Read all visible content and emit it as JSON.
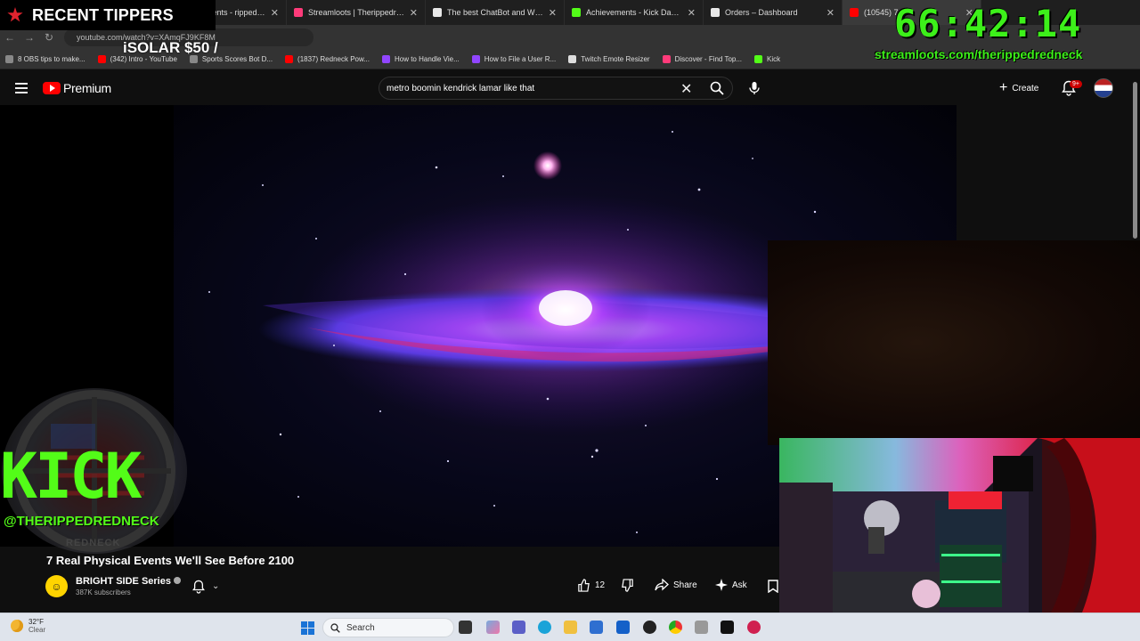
{
  "browser": {
    "tabs": [
      {
        "label": "Streamelements - rippedredne",
        "favicon_color": "#6bb7ff",
        "active": false
      },
      {
        "label": "Streamloots | Therippedredne",
        "favicon_color": "#ff3b7a",
        "active": false
      },
      {
        "label": "The best ChatBot and Widgets",
        "favicon_color": "#e8e8e8",
        "active": false
      },
      {
        "label": "Achievements - Kick Dashboar",
        "favicon_color": "#53fc18",
        "active": false
      },
      {
        "label": "Orders – Dashboard",
        "favicon_color": "#e8e8e8",
        "active": false
      },
      {
        "label": "(10545) 7 R",
        "favicon_color": "#ff0000",
        "active": true
      }
    ],
    "address": "youtube.com/watch?v=XAmqFJ9KF8M",
    "bookmarks": [
      {
        "label": "8 OBS tips to make...",
        "color": "#888888"
      },
      {
        "label": "(342) Intro - YouTube",
        "color": "#ff0000"
      },
      {
        "label": "Sports Scores Bot D...",
        "color": "#888888"
      },
      {
        "label": "(1837) Redneck Pow...",
        "color": "#ff0000"
      },
      {
        "label": "How to Handle Vie...",
        "color": "#9146ff"
      },
      {
        "label": "How to File a User R...",
        "color": "#9146ff"
      },
      {
        "label": "Twitch Emote Resizer",
        "color": "#dddddd"
      },
      {
        "label": "Discover - Find Top...",
        "color": "#ff3b7a"
      },
      {
        "label": "Kick",
        "color": "#53fc18"
      }
    ]
  },
  "youtube": {
    "brand": "Premium",
    "search_query": "metro boomin kendrick lamar like that",
    "create_label": "Create",
    "notification_badge": "9+",
    "video_title": "7 Real Physical Events We'll See Before 2100",
    "channel": {
      "name": "BRIGHT SIDE Series",
      "subscribers": "387K subscribers"
    },
    "actions": {
      "like_count": "12",
      "share": "Share",
      "ask": "Ask"
    }
  },
  "overlays": {
    "tippers_title": "RECENT TIPPERS",
    "tipper_entry": "iSOLAR $50 /",
    "timer": "66:42:14",
    "streamloots_url": "streamloots.com/therippedredneck",
    "kick_logo": "KICK",
    "kick_handle": "@THERIPPEDREDNECK",
    "emblem_text": "REDNECK"
  },
  "taskbar": {
    "temperature": "32°F",
    "condition": "Clear",
    "search_label": "Search"
  }
}
